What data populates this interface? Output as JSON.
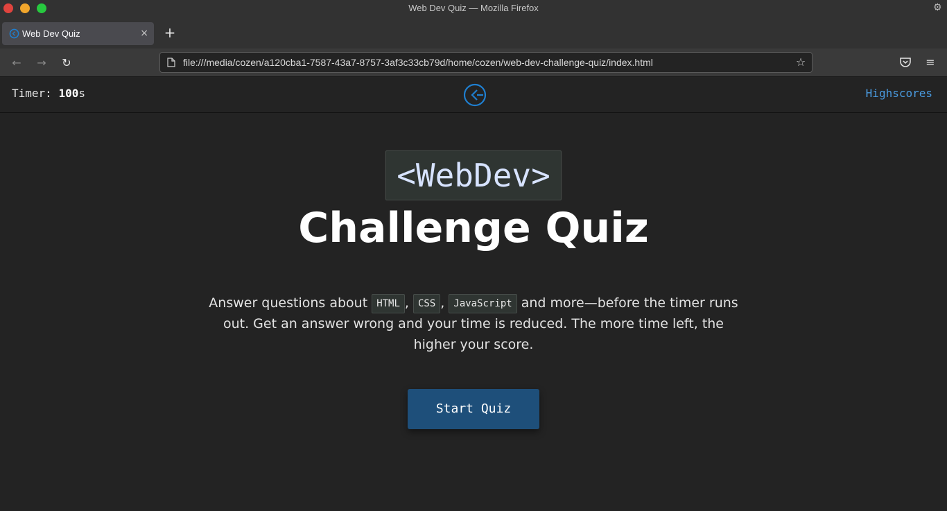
{
  "window": {
    "title": "Web Dev Quiz — Mozilla Firefox"
  },
  "tabs": [
    {
      "label": "Web Dev Quiz",
      "close": "×"
    }
  ],
  "toolbar": {
    "new_tab": "+",
    "back": "←",
    "forward": "→",
    "reload": "↻",
    "url": "file:///media/cozen/a120cba1-7587-43a7-8757-3af3c33cb79d/home/cozen/web-dev-challenge-quiz/index.html",
    "bookmark_star": "☆",
    "menu": "≡"
  },
  "header": {
    "timer_label": "Timer: ",
    "timer_value": "100",
    "timer_unit": "s",
    "highscores": "Highscores"
  },
  "hero": {
    "code_badge": "<WebDev>",
    "title": "Challenge Quiz",
    "desc_part1": "Answer questions about ",
    "tag_html": "HTML",
    "sep1": ", ",
    "tag_css": "CSS",
    "sep2": ", ",
    "tag_js": "JavaScript",
    "desc_part2": " and more—before the timer runs out. Get an answer wrong and your time is reduced. The more time left, the higher your score.",
    "start_button": "Start Quiz"
  },
  "colors": {
    "accent": "#4a9be0",
    "button_bg": "#1e4f7a",
    "page_bg": "#232323"
  },
  "icons": [
    "gear-icon",
    "favicon-icon",
    "page-icon",
    "star-icon",
    "pocket-icon",
    "hamburger-menu-icon",
    "logo-icon"
  ]
}
